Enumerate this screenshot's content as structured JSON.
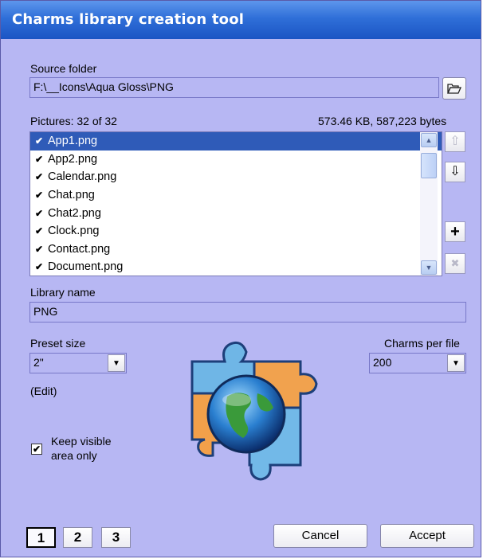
{
  "window": {
    "title": "Charms library creation tool"
  },
  "source": {
    "label": "Source folder",
    "value": "F:\\__Icons\\Aqua Gloss\\PNG"
  },
  "pictures": {
    "count_label": "Pictures: 32 of 32",
    "size_label": "573.46 KB, 587,223 bytes",
    "items": [
      "App1.png",
      "App2.png",
      "Calendar.png",
      "Chat.png",
      "Chat2.png",
      "Clock.png",
      "Contact.png",
      "Document.png"
    ]
  },
  "library": {
    "label": "Library name",
    "value": "PNG"
  },
  "preset": {
    "label": "Preset size",
    "value": "2\"",
    "edit": "(Edit)"
  },
  "charms": {
    "label": "Charms per file",
    "value": "200"
  },
  "keep_visible": {
    "label_line1": "Keep visible",
    "label_line2": "area only",
    "checked": true
  },
  "tabs": [
    "1",
    "2",
    "3"
  ],
  "buttons": {
    "cancel": "Cancel",
    "accept": "Accept"
  },
  "icons": {
    "folder": "folder-open-icon",
    "up": "arrow-up-icon",
    "down": "arrow-down-icon",
    "add": "plus-icon",
    "remove": "x-icon",
    "logo": "puzzle-globe-logo"
  }
}
